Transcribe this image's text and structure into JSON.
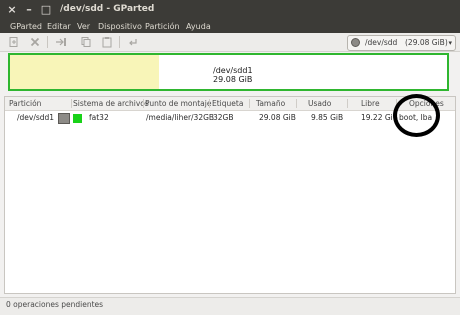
{
  "window": {
    "title": "/dev/sdd - GParted",
    "buttons": {
      "close": "×",
      "minimize": "–",
      "maximize": "□"
    }
  },
  "menu": [
    "GParted",
    "Editar",
    "Ver",
    "Dispositivo",
    "Partición",
    "Ayuda"
  ],
  "toolbar": {
    "icons": [
      "new-partition-icon",
      "delete-icon",
      "resize-move-icon",
      "copy-icon",
      "paste-icon",
      "undo-icon"
    ],
    "device": "/dev/sdd",
    "device_size": "(29.08 GiB)"
  },
  "partition_map": {
    "name": "/dev/sdd1",
    "size": "29.08 GiB",
    "used_fraction": 0.34,
    "used_color": "#f8f5b8",
    "border_color": "#2fb62f"
  },
  "table": {
    "headers": [
      "Partición",
      "Sistema de archivos",
      "Punto de montaje",
      "Etiqueta",
      "Tamaño",
      "Usado",
      "Libre",
      "Opciones"
    ],
    "rows": [
      {
        "partition": "/dev/sdd1",
        "filesystem": "fat32",
        "fs_color": "#19d219",
        "mountpoint": "/media/liher/32GB",
        "label": "32GB",
        "size": "29.08 GiB",
        "used": "9.85 GiB",
        "free": "19.22 GiB",
        "flags": "boot, lba"
      }
    ]
  },
  "status": "0 operaciones pendientes"
}
